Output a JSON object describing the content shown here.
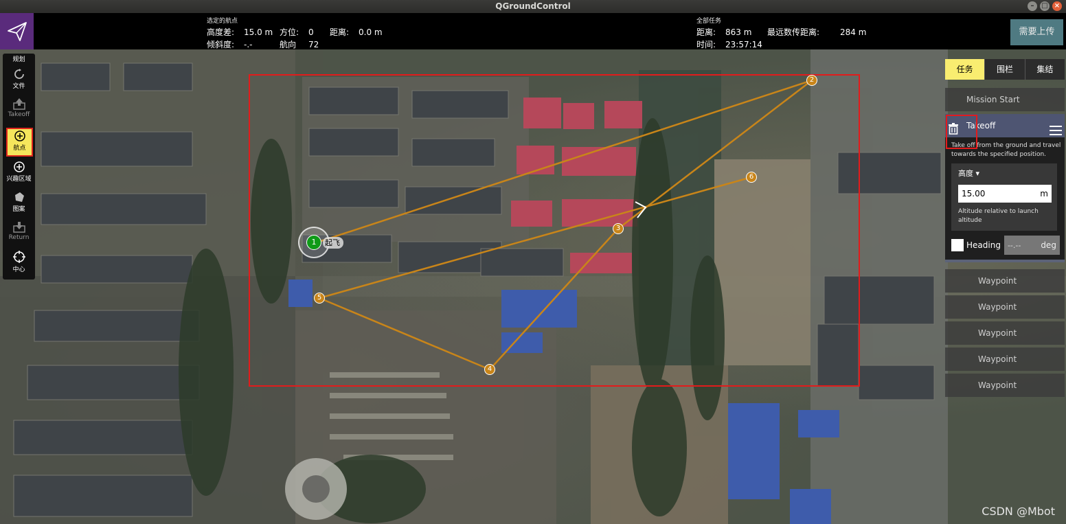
{
  "window": {
    "title": "QGroundControl"
  },
  "toolbar": {
    "selected_wp": {
      "header": "选定的航点",
      "alt_diff_label": "高度差:",
      "alt_diff_value": "15.0 m",
      "azimuth_label": "方位:",
      "azimuth_value": "0",
      "distance_label": "距离:",
      "distance_value": "0.0 m",
      "gradient_label": "倾斜度:",
      "gradient_value": "-.-",
      "heading_label": "航向",
      "heading_value": "72"
    },
    "total_mission": {
      "header": "全部任务",
      "distance_label": "距离:",
      "distance_value": "863 m",
      "max_telem_label": "最远数传距离:",
      "max_telem_value": "284 m",
      "time_label": "时间:",
      "time_value": "23:57:14"
    },
    "upload_label": "需要上传"
  },
  "tools": [
    {
      "label": "规划",
      "icon": "plan-icon"
    },
    {
      "label": "文件",
      "icon": "sync-icon"
    },
    {
      "label": "Takeoff",
      "icon": "takeoff-icon"
    },
    {
      "label": "航点",
      "icon": "add-waypoint-icon"
    },
    {
      "label": "兴趣区域",
      "icon": "add-roi-icon"
    },
    {
      "label": "图案",
      "icon": "pattern-icon"
    },
    {
      "label": "Return",
      "icon": "return-icon"
    },
    {
      "label": "中心",
      "icon": "center-icon"
    }
  ],
  "map": {
    "takeoff_label": "起飞",
    "waypoints": [
      "1",
      "2",
      "3",
      "4",
      "5",
      "6"
    ]
  },
  "panel": {
    "tabs": [
      "任务",
      "围栏",
      "集结"
    ],
    "mission_start": "Mission Start",
    "takeoff": {
      "title": "Takeoff",
      "description": "Take off from the ground and travel towards the specified position.",
      "altitude_label": "高度",
      "altitude_value": "15.00",
      "altitude_unit": "m",
      "altitude_note": "Altitude relative to launch altitude",
      "heading_label": "Heading",
      "heading_value": "--.--",
      "heading_unit": "deg"
    },
    "waypoints": [
      "Waypoint",
      "Waypoint",
      "Waypoint",
      "Waypoint",
      "Waypoint"
    ]
  },
  "watermark": "CSDN @Mbot",
  "colors": {
    "flight_path": "#c98519",
    "annotation_red": "#e31b1b",
    "active_tab": "#f9ed70",
    "logo_bg": "#5a2b7c",
    "home_marker": "#0f9a18"
  }
}
